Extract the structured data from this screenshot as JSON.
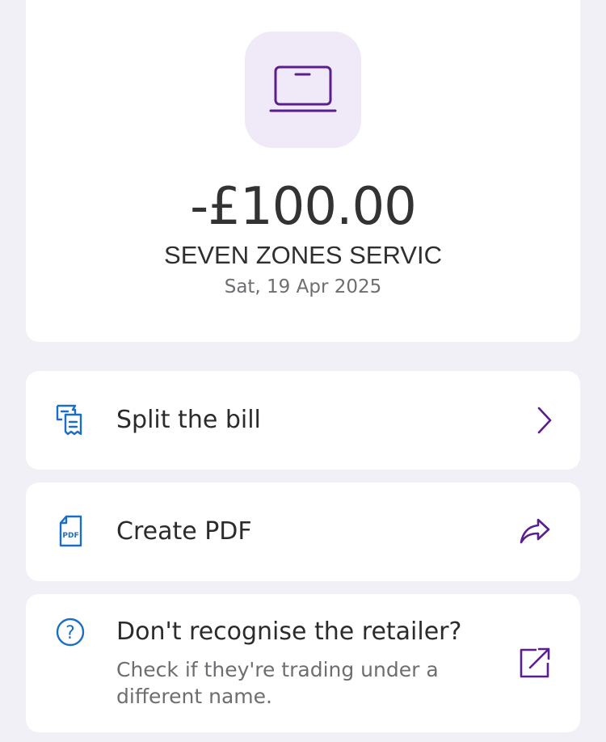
{
  "transaction": {
    "amount": "-£100.00",
    "merchant": "SEVEN ZONES SERVIC",
    "date": "Sat, 19 Apr 2025",
    "icon": "laptop-icon"
  },
  "actions": [
    {
      "label": "Split the bill",
      "icon": "receipt-split-icon",
      "trail_icon": "chevron-right-icon"
    },
    {
      "label": "Create PDF",
      "icon": "pdf-document-icon",
      "trail_icon": "share-icon"
    },
    {
      "label": "Don't recognise the retailer?",
      "sublabel": "Check if they're trading under a different name.",
      "icon": "question-circle-icon",
      "trail_icon": "external-link-icon"
    }
  ],
  "colors": {
    "background": "#f1f0f6",
    "card": "#ffffff",
    "accent_purple": "#5b1e8f",
    "icon_blue": "#1a6fc4",
    "icon_tile": "#f0eaf8"
  }
}
